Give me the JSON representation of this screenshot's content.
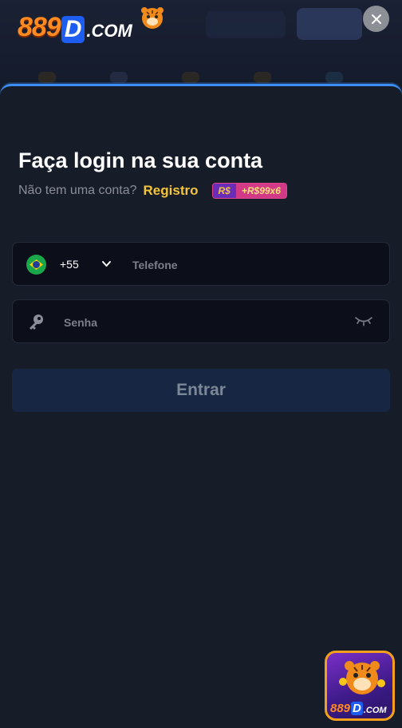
{
  "brand": {
    "logo_number": "889",
    "logo_letter": "D",
    "logo_suffix": ".COM"
  },
  "login": {
    "title": "Faça login na sua conta",
    "subtitle": "Não tem uma conta?",
    "register_link": "Registro",
    "bonus_currency": "R$",
    "bonus_value": "+R$99x6"
  },
  "phone": {
    "country_code": "+55",
    "placeholder": "Telefone",
    "value": ""
  },
  "password": {
    "placeholder": "Senha",
    "value": ""
  },
  "submit": {
    "label": "Entrar"
  },
  "float_app": {
    "logo_number": "889",
    "logo_letter": "D",
    "logo_suffix": ".COM"
  },
  "colors": {
    "accent_blue": "#3d8ef5",
    "register_gold": "#f3c53a",
    "background": "#171c29",
    "button_bg": "#172743"
  },
  "icons": [
    "close-icon",
    "brazil-flag-icon",
    "chevron-down-icon",
    "key-icon",
    "eye-closed-icon"
  ]
}
